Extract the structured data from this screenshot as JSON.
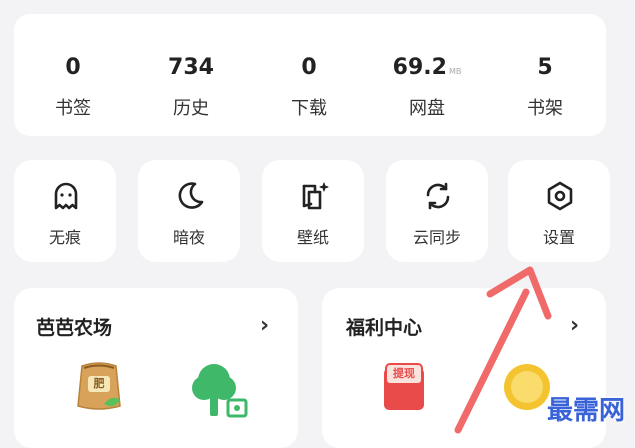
{
  "stats": [
    {
      "value": "0",
      "unit": "",
      "label": "书签"
    },
    {
      "value": "734",
      "unit": "",
      "label": "历史"
    },
    {
      "value": "0",
      "unit": "",
      "label": "下载"
    },
    {
      "value": "69.2",
      "unit": "MB",
      "label": "网盘"
    },
    {
      "value": "5",
      "unit": "",
      "label": "书架"
    }
  ],
  "tools": [
    {
      "label": "无痕",
      "icon": "ghost-icon"
    },
    {
      "label": "暗夜",
      "icon": "moon-icon"
    },
    {
      "label": "壁纸",
      "icon": "wallpaper-icon"
    },
    {
      "label": "云同步",
      "icon": "sync-icon"
    },
    {
      "label": "设置",
      "icon": "settings-hexagon-icon"
    }
  ],
  "cards": {
    "farm": {
      "title": "芭芭农场",
      "chevron": "›",
      "sack_label": "肥"
    },
    "welfare": {
      "title": "福利中心",
      "chevron": "›",
      "envelope_label": "提现"
    }
  },
  "watermark": "最需网",
  "colors": {
    "background": "#f3f3f5",
    "card": "#ffffff",
    "arrow": "#f06a6a",
    "watermark": "#3b63d8",
    "tree": "#3fb86a",
    "envelope": "#e94b4b",
    "coin": "#f4c430"
  }
}
